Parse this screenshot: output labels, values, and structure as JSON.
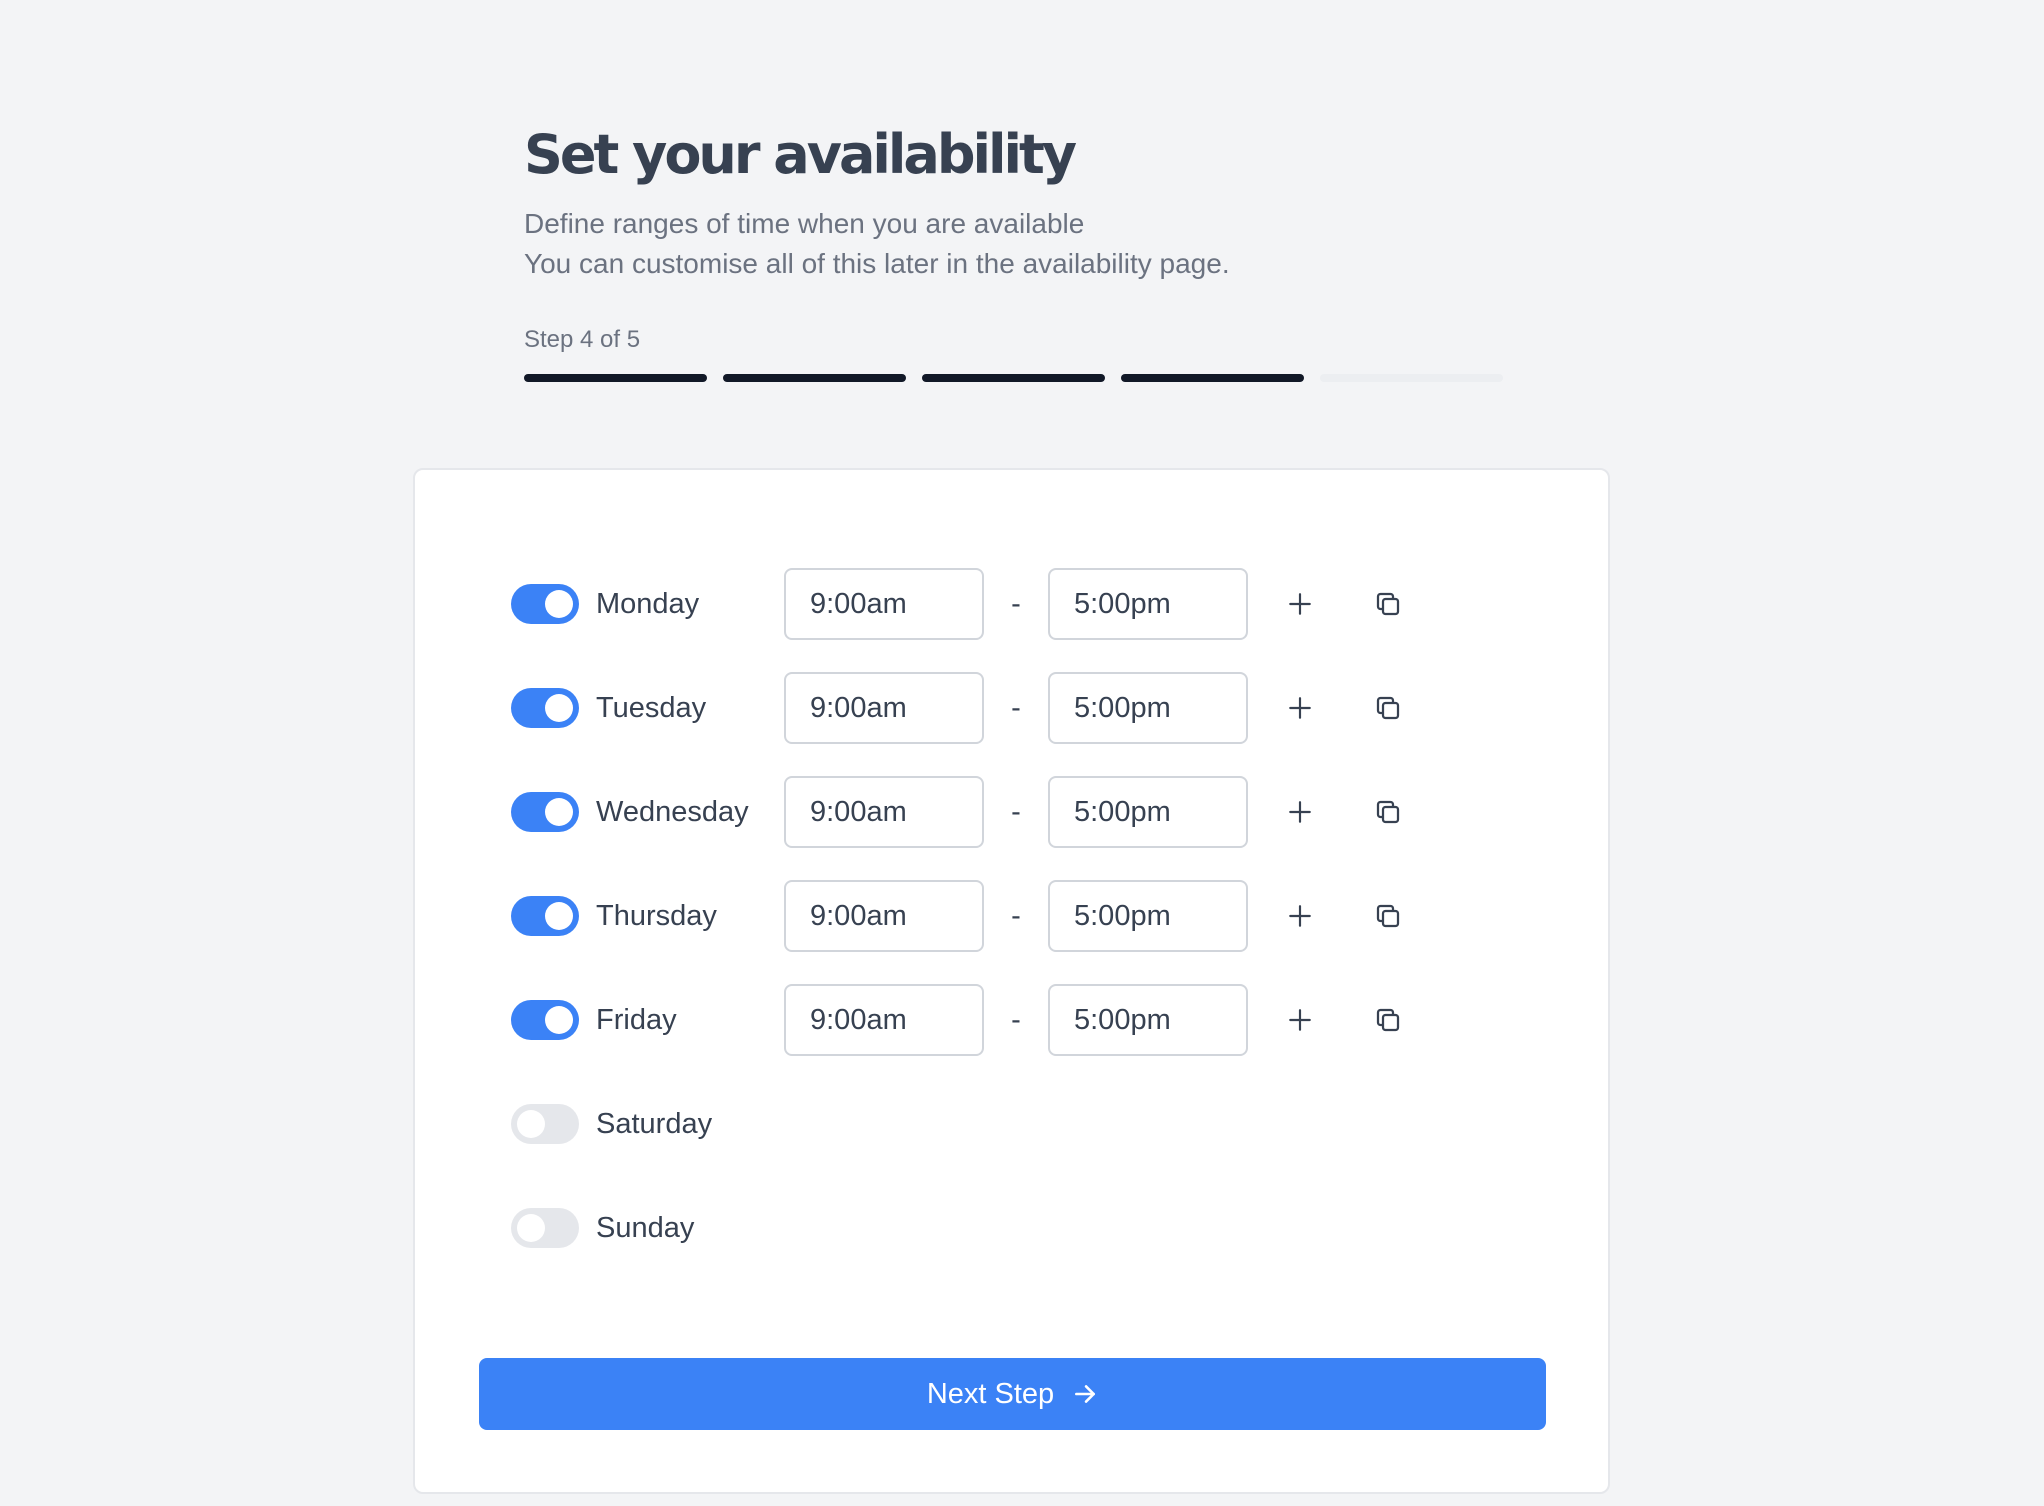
{
  "header": {
    "title": "Set your availability",
    "subtitle_line1": "Define ranges of time when you are available",
    "subtitle_line2": "You can customise all of this later in the availability page.",
    "step_label": "Step 4 of 5",
    "current_step": 4,
    "total_steps": 5
  },
  "schedule": {
    "separator": "-",
    "days": [
      {
        "label": "Monday",
        "enabled": true,
        "start": "9:00am",
        "end": "5:00pm"
      },
      {
        "label": "Tuesday",
        "enabled": true,
        "start": "9:00am",
        "end": "5:00pm"
      },
      {
        "label": "Wednesday",
        "enabled": true,
        "start": "9:00am",
        "end": "5:00pm"
      },
      {
        "label": "Thursday",
        "enabled": true,
        "start": "9:00am",
        "end": "5:00pm"
      },
      {
        "label": "Friday",
        "enabled": true,
        "start": "9:00am",
        "end": "5:00pm"
      },
      {
        "label": "Saturday",
        "enabled": false
      },
      {
        "label": "Sunday",
        "enabled": false
      }
    ]
  },
  "footer": {
    "next_label": "Next Step"
  },
  "colors": {
    "accent": "#3b82f6",
    "progress_done": "#111827",
    "progress_todo": "#eceef1",
    "toggle_off": "#e5e7eb"
  },
  "icons": {
    "add": "plus-icon",
    "copy": "copy-icon",
    "next": "arrow-right-icon"
  }
}
